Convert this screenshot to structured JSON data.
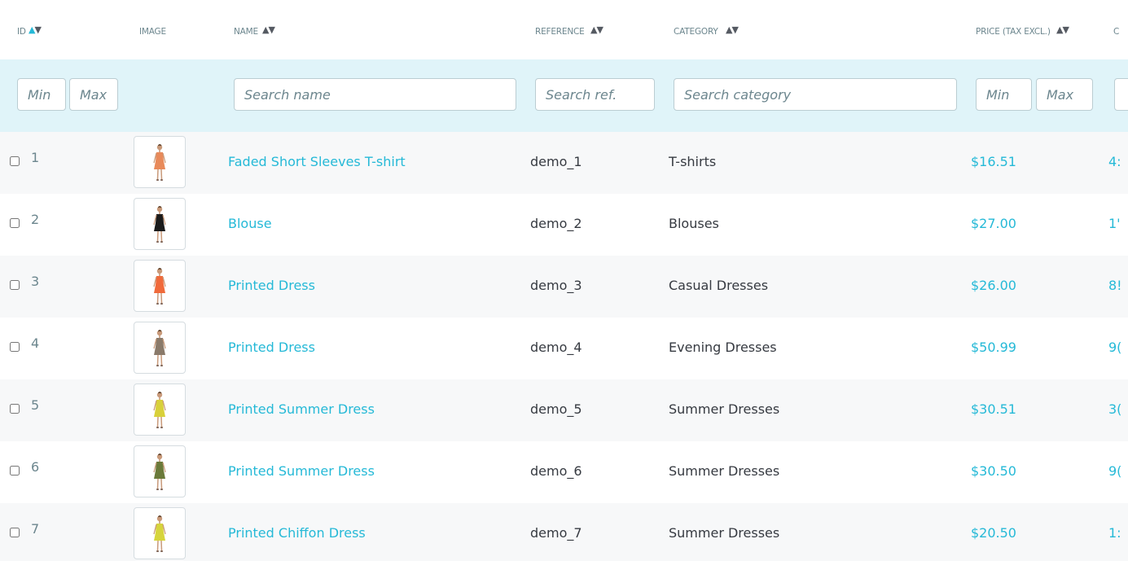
{
  "header": {
    "id": "ID",
    "image": "IMAGE",
    "name": "NAME",
    "reference": "REFERENCE",
    "category": "CATEGORY",
    "price": "PRICE (TAX EXCL.)",
    "quantity_partial": "C",
    "sort_arrows": "▲▼"
  },
  "filters": {
    "id_min": "Min",
    "id_max": "Max",
    "name": "Search name",
    "reference": "Search ref.",
    "category": "Search category",
    "price_min": "Min",
    "price_max": "Max"
  },
  "colors": {
    "accent": "#25b9d7",
    "filter_bg": "#e0f4f9",
    "text": "#363a41",
    "muted": "#6c868e"
  },
  "rows": [
    {
      "id": "1",
      "name": "Faded Short Sleeves T-shirt",
      "reference": "demo_1",
      "category": "T-shirts",
      "price": "$16.51",
      "quantity_partial": "4:",
      "image_icon": "product-thumbnail-icon",
      "dress": "#e88a5a"
    },
    {
      "id": "2",
      "name": "Blouse",
      "reference": "demo_2",
      "category": "Blouses",
      "price": "$27.00",
      "quantity_partial": "1'",
      "image_icon": "product-thumbnail-icon",
      "dress": "#1b1b1b"
    },
    {
      "id": "3",
      "name": "Printed Dress",
      "reference": "demo_3",
      "category": "Casual Dresses",
      "price": "$26.00",
      "quantity_partial": "8!",
      "image_icon": "product-thumbnail-icon",
      "dress": "#f06a3b"
    },
    {
      "id": "4",
      "name": "Printed Dress",
      "reference": "demo_4",
      "category": "Evening Dresses",
      "price": "$50.99",
      "quantity_partial": "9(",
      "image_icon": "product-thumbnail-icon",
      "dress": "#8a7a6a"
    },
    {
      "id": "5",
      "name": "Printed Summer Dress",
      "reference": "demo_5",
      "category": "Summer Dresses",
      "price": "$30.51",
      "quantity_partial": "3(",
      "image_icon": "product-thumbnail-icon",
      "dress": "#d8d03a"
    },
    {
      "id": "6",
      "name": "Printed Summer Dress",
      "reference": "demo_6",
      "category": "Summer Dresses",
      "price": "$30.50",
      "quantity_partial": "9(",
      "image_icon": "product-thumbnail-icon",
      "dress": "#6b7a3a"
    },
    {
      "id": "7",
      "name": "Printed Chiffon Dress",
      "reference": "demo_7",
      "category": "Summer Dresses",
      "price": "$20.50",
      "quantity_partial": "1:",
      "image_icon": "product-thumbnail-icon",
      "dress": "#d6d43c"
    }
  ]
}
